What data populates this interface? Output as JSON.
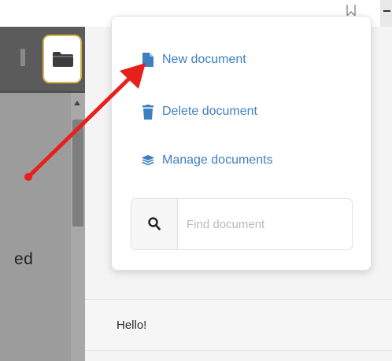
{
  "left_panel": {
    "partial_text": "ed"
  },
  "menu": {
    "items": [
      {
        "label": "New document",
        "icon": "file-icon"
      },
      {
        "label": "Delete document",
        "icon": "trash-icon"
      },
      {
        "label": "Manage documents",
        "icon": "layers-icon"
      }
    ]
  },
  "search": {
    "placeholder": "Find document",
    "value": "",
    "icon": "search-icon"
  },
  "content": {
    "hello": "Hello!"
  },
  "colors": {
    "menu_link": "#3e7fc1",
    "annotation_arrow": "#e8201b",
    "folder_outline": "#d8b54a"
  }
}
